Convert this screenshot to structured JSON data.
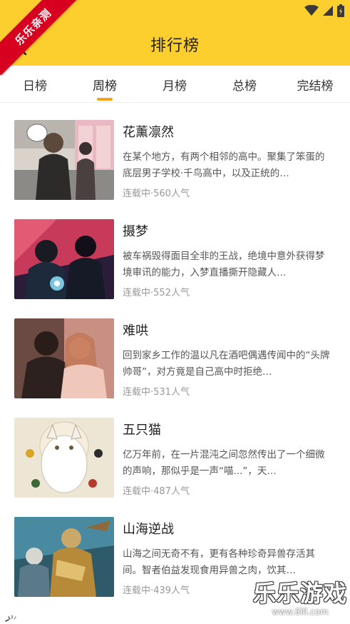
{
  "header": {
    "title": "排行榜",
    "bg_color": "#FCCF2E",
    "back_icon": "back-arrow-icon"
  },
  "status_bar": {
    "icons": [
      "wifi-icon",
      "cellular-signal-icon",
      "battery-charging-icon"
    ]
  },
  "watermark": {
    "ribbon_text": "乐乐亲测",
    "bottom_text": "乐乐游戏",
    "bottom_url": "www.6lll.com"
  },
  "tabs": [
    {
      "label": "日榜",
      "active": false
    },
    {
      "label": "周榜",
      "active": true
    },
    {
      "label": "月榜",
      "active": false
    },
    {
      "label": "总榜",
      "active": false
    },
    {
      "label": "完结榜",
      "active": false
    }
  ],
  "accent_color": "#F7A21B",
  "comics": [
    {
      "title": "花薰凛然",
      "description": "在某个地方，有两个相邻的高中。聚集了笨蛋的底层男子学校·千鸟高中，以及正统的…",
      "status": "连载中·560人气"
    },
    {
      "title": "摄梦",
      "description": "被车祸毁得面目全非的王战，绝境中意外获得梦境审讯的能力，入梦直播撕开隐藏人…",
      "status": "连载中·552人气"
    },
    {
      "title": "难哄",
      "description": "回到家乡工作的温以凡在酒吧偶遇传闻中的“头牌帅哥”，对方竟是自己高中时拒绝…",
      "status": "连载中·531人气"
    },
    {
      "title": "五只猫",
      "description": "亿万年前，在一片混沌之间忽然传出了一个细微的声响，那似乎是一声“喵...”，天…",
      "status": "连载中·487人气"
    },
    {
      "title": "山海逆战",
      "description": "山海之间无奇不有，更有各种珍奇异兽存活其间。智者伯益发现食用异兽之肉，饮其…",
      "status": "连载中·439人气"
    }
  ]
}
